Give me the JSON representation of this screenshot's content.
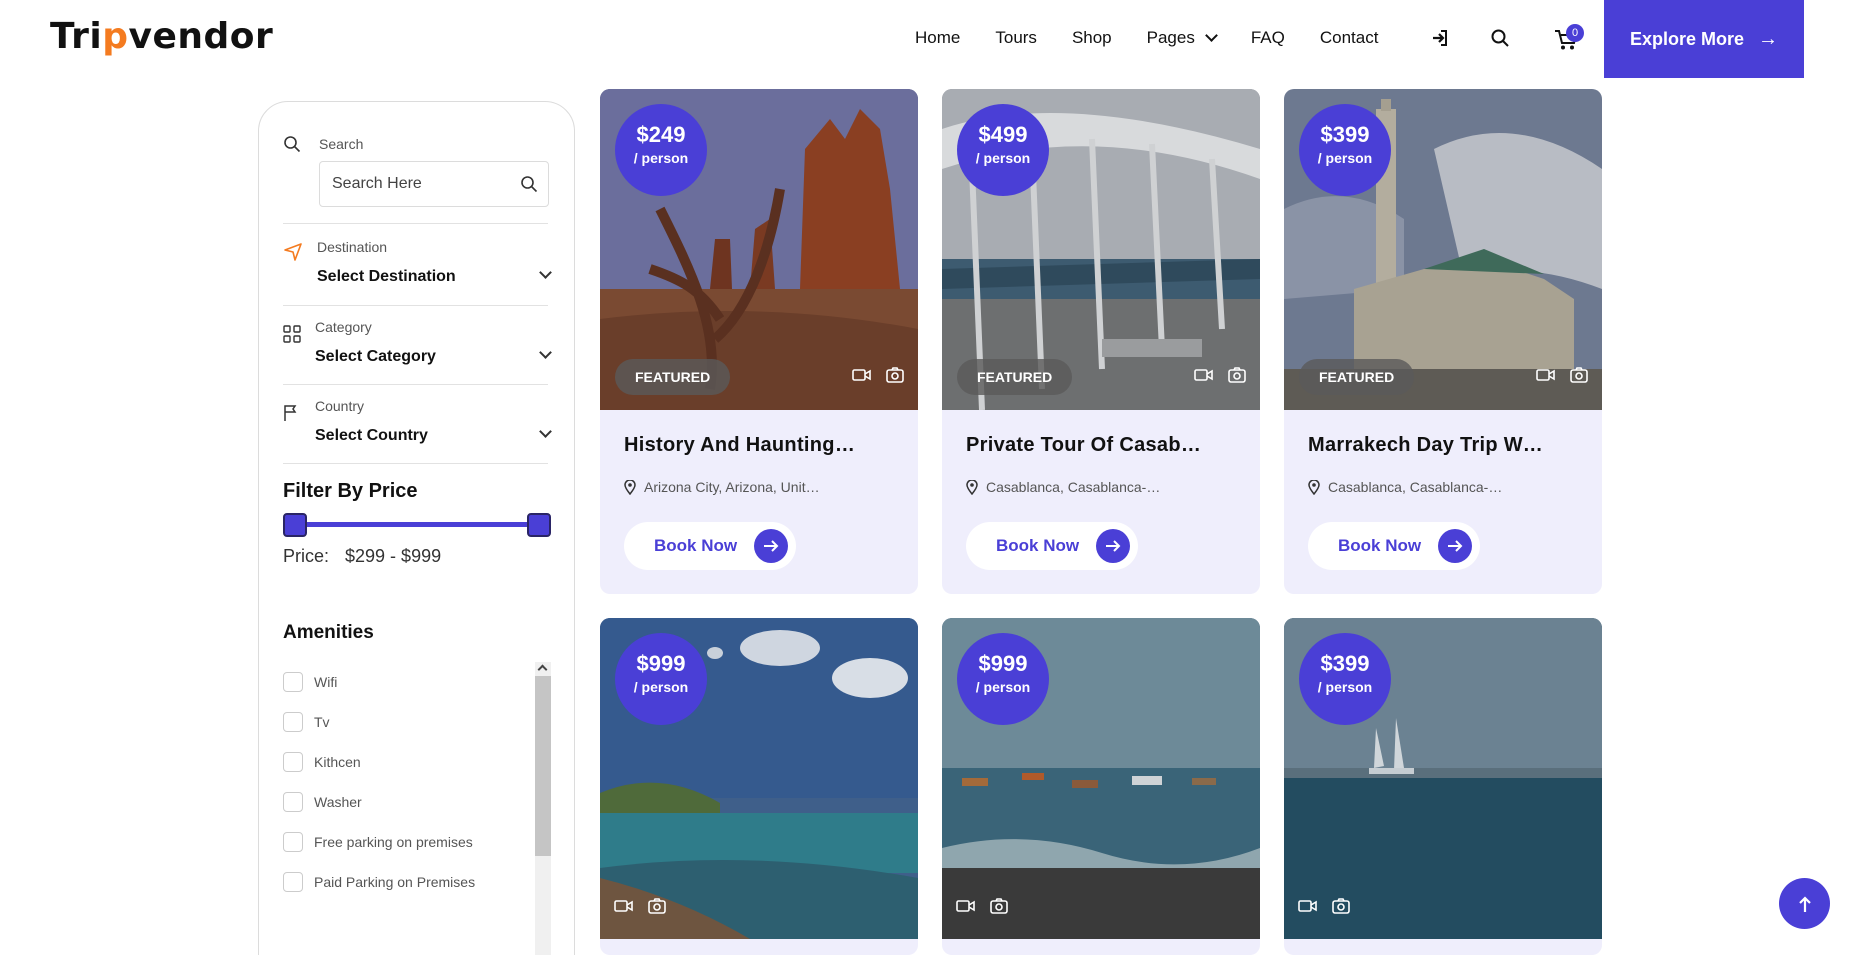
{
  "header": {
    "logo_prefix": "Tri",
    "logo_accent": "p",
    "logo_suffix": "vendor",
    "nav": [
      "Home",
      "Tours",
      "Shop",
      "Pages",
      "FAQ",
      "Contact"
    ],
    "cart_count": "0",
    "explore_label": "Explore More"
  },
  "sidebar": {
    "search_label": "Search",
    "search_placeholder": "Search Here",
    "destination_label": "Destination",
    "destination_value": "Select Destination",
    "category_label": "Category",
    "category_value": "Select Category",
    "country_label": "Country",
    "country_value": "Select Country",
    "filter_title": "Filter By Price",
    "price_label": "Price:",
    "price_value": "$299 - $999",
    "amenities_title": "Amenities",
    "amenities": [
      "Wifi",
      "Tv",
      "Kithcen",
      "Washer",
      "Free parking on premises",
      "Paid Parking on Premises"
    ]
  },
  "cards": [
    {
      "price": "$249",
      "per": "/ person",
      "featured": "FEATURED",
      "title": "History And Hauntings Of Salem",
      "location": "Arizona City, Arizona, United States",
      "book": "Book Now"
    },
    {
      "price": "$499",
      "per": "/ person",
      "featured": "FEATURED",
      "title": "Private Tour Of Casablanca",
      "location": "Casablanca, Casablanca-Settat, Morocco",
      "book": "Book Now"
    },
    {
      "price": "$399",
      "per": "/ person",
      "featured": "FEATURED",
      "title": "Marrakech Day Trip With Camel Ride",
      "location": "Casablanca, Casablanca-Settat, Morocco",
      "book": "Book Now"
    },
    {
      "price": "$999",
      "per": "/ person"
    },
    {
      "price": "$999",
      "per": "/ person"
    },
    {
      "price": "$399",
      "per": "/ person"
    }
  ],
  "colors": {
    "brand": "#4a3fd6",
    "accent": "#f47b20",
    "card_bg": "#efeefc"
  }
}
